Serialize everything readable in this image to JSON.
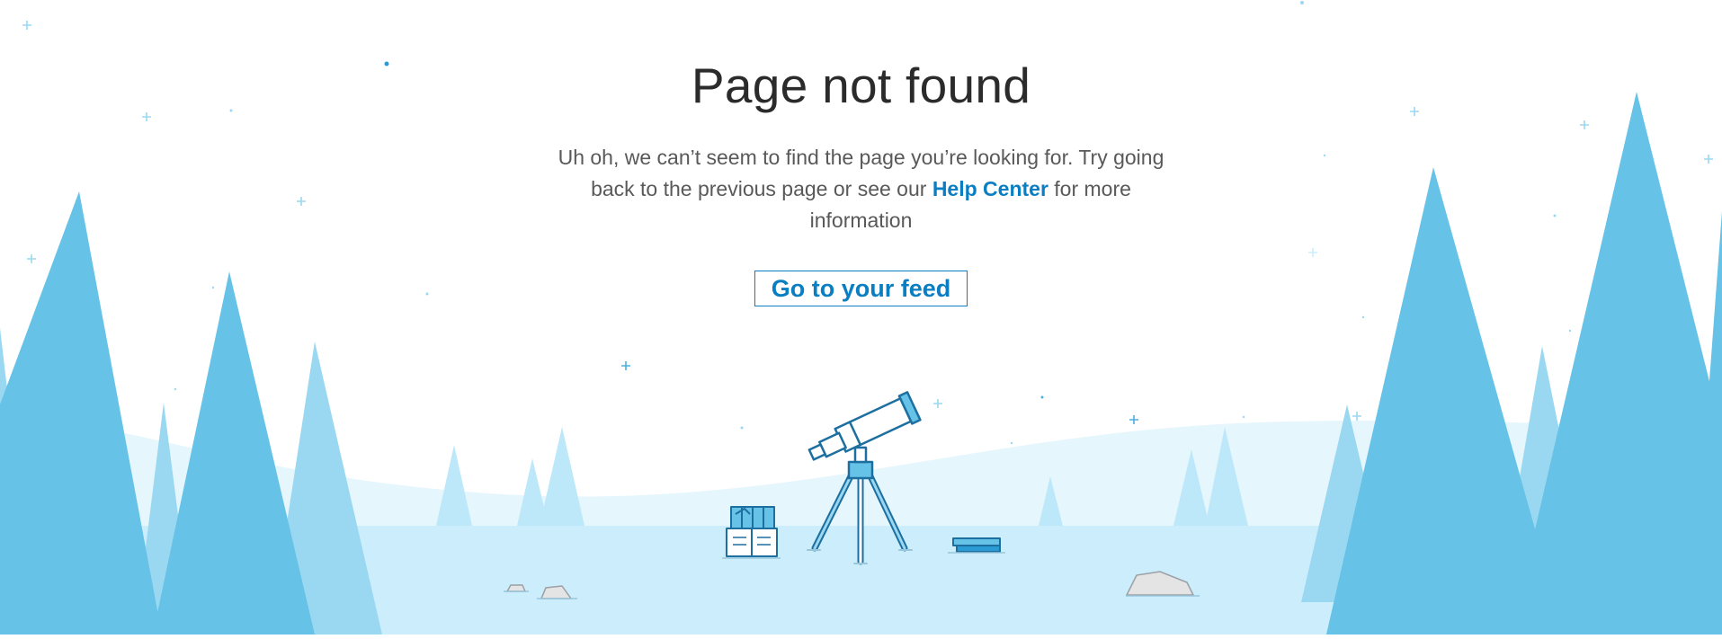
{
  "page": {
    "title": "Page not found",
    "description_before_link": "Uh oh, we can’t seem to find the page you’re looking for. Try going back to the previous page or see our ",
    "help_link_label": "Help Center",
    "description_after_link": " for more information",
    "feed_button_label": "Go to your feed"
  },
  "colors": {
    "accent": "#0a7ec2",
    "title": "#2b2b2b",
    "body_text": "#595959",
    "tree_dark": "#66c2e6",
    "tree_light": "#9ad8f2",
    "ground": "#cceefc",
    "hill": "#e6f6fd"
  },
  "illustration": {
    "icons": [
      "telescope-icon",
      "books-icon",
      "book-stack-icon",
      "rock-icon"
    ]
  }
}
